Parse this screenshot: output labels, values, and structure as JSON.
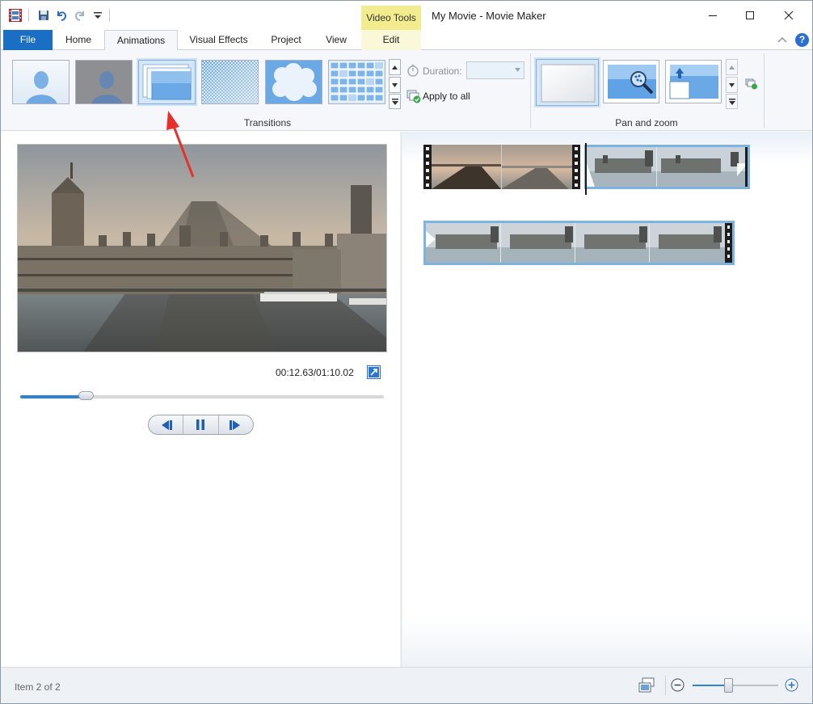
{
  "titlebar": {
    "title": "My Movie - Movie Maker",
    "contextual_tab_group": "Video Tools"
  },
  "ribbon_tabs": {
    "file": "File",
    "home": "Home",
    "animations": "Animations",
    "visual_effects": "Visual Effects",
    "project": "Project",
    "view": "View",
    "edit": "Edit",
    "active": "Animations"
  },
  "transitions_group": {
    "label": "Transitions",
    "items": [
      "none",
      "crossfade",
      "zoom-box",
      "dissolve",
      "cloud",
      "mosaic"
    ],
    "selected": "zoom-box",
    "duration_label": "Duration:",
    "duration_value": "",
    "apply_to_all": "Apply to all"
  },
  "pan_zoom_group": {
    "label": "Pan and zoom",
    "items": [
      "none",
      "zoom-in",
      "pan-up"
    ],
    "selected": "none"
  },
  "preview": {
    "time": "00:12.63/01:10.02",
    "position_fraction": 0.18
  },
  "storyboard": {
    "clips": [
      "pier",
      "parliament",
      "parliament"
    ],
    "selected_clip": 2
  },
  "statusbar": {
    "status": "Item 2 of 2",
    "zoom_fraction": 0.42
  },
  "colors": {
    "accent": "#1a6ec3",
    "video_tools": "#f3ec8e",
    "selection": "#7db3e0",
    "annotation_arrow": "#e8302a"
  }
}
